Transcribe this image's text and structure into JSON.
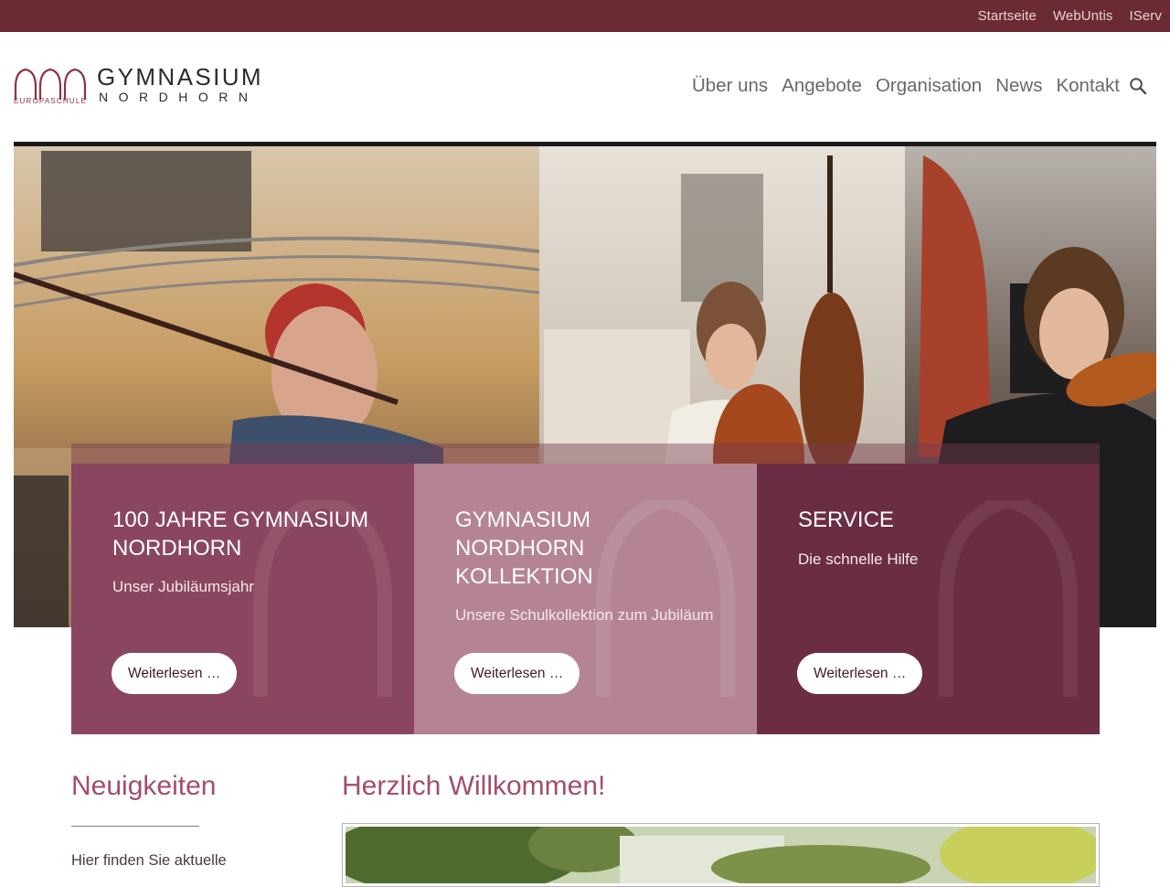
{
  "top_links": [
    "Startseite",
    "WebUntis",
    "IServ"
  ],
  "logo": {
    "title": "GYMNASIUM",
    "subtitle": "NORDHORN",
    "tagline": "EUROPASCHULE"
  },
  "main_nav": [
    "Über uns",
    "Angebote",
    "Organisation",
    "News",
    "Kontakt"
  ],
  "colors": {
    "brand_dark": "#6b2b35",
    "card_1": "#8a4660",
    "card_2": "#b48495",
    "card_3": "#6b2d43",
    "heading_accent": "#a34d6c"
  },
  "cards": [
    {
      "title": "100 JAHRE GYMNASIUM NORDHORN",
      "subtitle": "Unser Jubiläumsjahr",
      "button": "Weiterlesen …"
    },
    {
      "title": "GYMNASIUM NORDHORN KOLLEKTION",
      "subtitle": "Unsere Schulkollektion zum Jubiläum",
      "button": "Weiterlesen …"
    },
    {
      "title": "SERVICE",
      "subtitle": "Die schnelle Hilfe",
      "button": "Weiterlesen …"
    }
  ],
  "news": {
    "heading": "Neuigkeiten",
    "intro": "Hier finden Sie aktuelle"
  },
  "welcome": {
    "heading": "Herzlich Willkommen!"
  }
}
